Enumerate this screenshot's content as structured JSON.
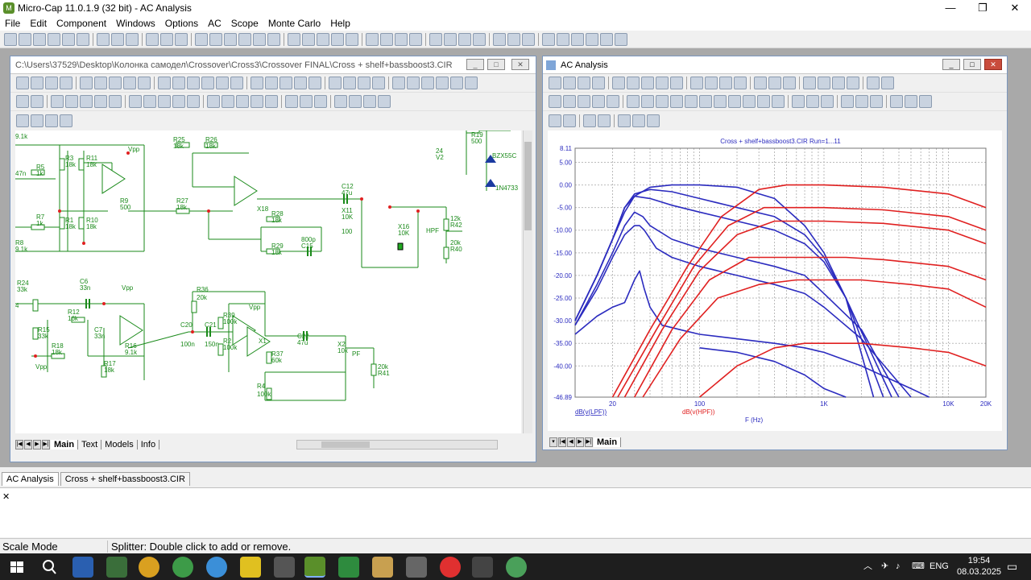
{
  "app": {
    "title": "Micro-Cap 11.0.1.9 (32 bit) - AC Analysis",
    "icon": "microcap-logo-icon"
  },
  "menu": [
    "File",
    "Edit",
    "Component",
    "Windows",
    "Options",
    "AC",
    "Scope",
    "Monte Carlo",
    "Help"
  ],
  "schematic": {
    "title": "C:\\Users\\37529\\Desktop\\Колонка самодел\\Crossover\\Cross3\\Crossover FINAL\\Cross + shelf+bassboost3.CIR",
    "tabs": [
      "Main",
      "Text",
      "Models",
      "Info"
    ],
    "labels": [
      {
        "t": "9.1k"
      },
      {
        "t": "Vpp"
      },
      {
        "t": "R25"
      },
      {
        "t": "18k"
      },
      {
        "t": "R26"
      },
      {
        "t": "18k"
      },
      {
        "t": "R19"
      },
      {
        "t": "500"
      },
      {
        "t": "24"
      },
      {
        "t": "V2"
      },
      {
        "t": "BZX55C"
      },
      {
        "t": "1N4733"
      },
      {
        "t": "R3"
      },
      {
        "t": "18k"
      },
      {
        "t": "R11"
      },
      {
        "t": "18k"
      },
      {
        "t": "R5"
      },
      {
        "t": "1k"
      },
      {
        "t": "47n"
      },
      {
        "t": "R9"
      },
      {
        "t": "500"
      },
      {
        "t": "R27"
      },
      {
        "t": "18k"
      },
      {
        "t": "X18"
      },
      {
        "t": "C12"
      },
      {
        "t": "47u"
      },
      {
        "t": "R28"
      },
      {
        "t": "18k"
      },
      {
        "t": "X11"
      },
      {
        "t": "10K"
      },
      {
        "t": "100"
      },
      {
        "t": "X16"
      },
      {
        "t": "10K"
      },
      {
        "t": "HPF"
      },
      {
        "t": "12k"
      },
      {
        "t": "R42"
      },
      {
        "t": "20k"
      },
      {
        "t": "R40"
      },
      {
        "t": "R7"
      },
      {
        "t": "1k"
      },
      {
        "t": "R1"
      },
      {
        "t": "18k"
      },
      {
        "t": "R10"
      },
      {
        "t": "18k"
      },
      {
        "t": "R29"
      },
      {
        "t": "18k"
      },
      {
        "t": "800p"
      },
      {
        "t": "C15"
      },
      {
        "t": "R8"
      },
      {
        "t": "9.1k"
      },
      {
        "t": "R24"
      },
      {
        "t": "33k"
      },
      {
        "t": "C6"
      },
      {
        "t": "33n"
      },
      {
        "t": "Vpp"
      },
      {
        "t": "R36"
      },
      {
        "t": "20k"
      },
      {
        "t": "R12"
      },
      {
        "t": "16k"
      },
      {
        "t": "C7"
      },
      {
        "t": "33n"
      },
      {
        "t": "R39"
      },
      {
        "t": "100k"
      },
      {
        "t": "Vpp"
      },
      {
        "t": "R15"
      },
      {
        "t": "33k"
      },
      {
        "t": "C20"
      },
      {
        "t": "C21"
      },
      {
        "t": "100n"
      },
      {
        "t": "150n"
      },
      {
        "t": "R2"
      },
      {
        "t": "100k"
      },
      {
        "t": "X1"
      },
      {
        "t": "C22"
      },
      {
        "t": "47u"
      },
      {
        "t": "R18"
      },
      {
        "t": "18k"
      },
      {
        "t": "R16"
      },
      {
        "t": "9.1k"
      },
      {
        "t": "R37"
      },
      {
        "t": "60k"
      },
      {
        "t": "X2"
      },
      {
        "t": "10k"
      },
      {
        "t": "PF"
      },
      {
        "t": "20k"
      },
      {
        "t": "R41"
      },
      {
        "t": "Vpp"
      },
      {
        "t": "R17"
      },
      {
        "t": "18k"
      },
      {
        "t": "R4"
      },
      {
        "t": "100k"
      },
      {
        "t": "4"
      }
    ]
  },
  "analysis": {
    "window_title": "AC Analysis",
    "tabs": [
      "Main"
    ],
    "chart_data": {
      "type": "line",
      "title": "Cross + shelf+bassboost3.CIR Run=1...11",
      "xlabel": "F (Hz)",
      "x_scale": "log",
      "xlim": [
        10,
        20000
      ],
      "x_ticks": [
        "20",
        "100",
        "1K",
        "10K",
        "20K"
      ],
      "y_ticks": [
        "8.11",
        "5.00",
        "0.00",
        "-5.00",
        "-10.00",
        "-15.00",
        "-20.00",
        "-25.00",
        "-30.00",
        "-35.00",
        "-40.00",
        "-46.89"
      ],
      "ylim": [
        -46.89,
        8.11
      ],
      "grid": true,
      "legend": [
        {
          "label": "dB(v(LPF))",
          "color": "#2b2bbf"
        },
        {
          "label": "dB(v(HPF))",
          "color": "#e02020"
        }
      ],
      "series": [
        {
          "color": "#2b2bbf",
          "x": [
            10,
            15,
            20,
            25,
            30,
            40,
            60,
            100,
            200,
            400,
            700,
            1000,
            1500,
            2500
          ],
          "y": [
            -30,
            -20,
            -12,
            -6,
            -2.5,
            -0.5,
            0,
            0,
            -0.5,
            -3,
            -9,
            -15,
            -25,
            -46.89
          ]
        },
        {
          "color": "#2b2bbf",
          "x": [
            10,
            15,
            20,
            25,
            30,
            40,
            60,
            100,
            200,
            400,
            700,
            1000,
            1500,
            3000
          ],
          "y": [
            -30,
            -20,
            -12,
            -5,
            -2,
            -1,
            -1.5,
            -3,
            -5,
            -7,
            -11,
            -16,
            -25,
            -46.89
          ]
        },
        {
          "color": "#2b2bbf",
          "x": [
            10,
            15,
            20,
            25,
            30,
            40,
            60,
            100,
            200,
            400,
            700,
            1000,
            1500,
            3500
          ],
          "y": [
            -30,
            -20,
            -12,
            -5,
            -2.5,
            -3,
            -4.5,
            -6,
            -8,
            -10,
            -13,
            -17,
            -25,
            -46.89
          ]
        },
        {
          "color": "#2b2bbf",
          "x": [
            10,
            15,
            20,
            25,
            30,
            35,
            40,
            60,
            100,
            200,
            400,
            700,
            1000,
            2000,
            4000
          ],
          "y": [
            -31,
            -22,
            -15,
            -9,
            -6,
            -7,
            -9,
            -12,
            -14,
            -16,
            -18,
            -20,
            -24,
            -32,
            -46.89
          ]
        },
        {
          "color": "#2b2bbf",
          "x": [
            10,
            15,
            20,
            25,
            30,
            33,
            36,
            45,
            60,
            100,
            200,
            400,
            700,
            1000,
            2000,
            5000
          ],
          "y": [
            -31,
            -23,
            -16,
            -11,
            -9,
            -9,
            -10,
            -14,
            -16,
            -18,
            -20,
            -22,
            -24,
            -27,
            -34,
            -46.89
          ]
        },
        {
          "color": "#2b2bbf",
          "x": [
            10,
            15,
            20,
            25,
            30,
            33,
            36,
            40,
            50,
            70,
            100,
            200,
            400,
            700,
            1000,
            2000,
            5000,
            7000
          ],
          "y": [
            -33,
            -29,
            -27,
            -26,
            -21,
            -19,
            -23,
            -27,
            -31,
            -32,
            -33,
            -34,
            -35,
            -36,
            -37,
            -40,
            -45,
            -46.89
          ]
        },
        {
          "color": "#2b2bbf",
          "x": [
            100,
            200,
            400,
            700,
            1000,
            1500
          ],
          "y": [
            -36,
            -37,
            -39,
            -42,
            -45,
            -46.89
          ]
        },
        {
          "color": "#e02020",
          "x": [
            20,
            40,
            80,
            150,
            300,
            500,
            1000,
            3000,
            10000,
            20000
          ],
          "y": [
            -46.89,
            -32,
            -18,
            -7,
            -1,
            0,
            0,
            -0.5,
            -2,
            -5
          ]
        },
        {
          "color": "#e02020",
          "x": [
            22,
            45,
            90,
            170,
            330,
            600,
            1000,
            3000,
            10000,
            20000
          ],
          "y": [
            -46.89,
            -32,
            -18,
            -9,
            -5,
            -5,
            -5,
            -5.5,
            -7,
            -10
          ]
        },
        {
          "color": "#e02020",
          "x": [
            25,
            50,
            100,
            200,
            400,
            700,
            1000,
            3000,
            10000,
            20000
          ],
          "y": [
            -46.89,
            -32,
            -19,
            -11,
            -8,
            -8,
            -8,
            -8.5,
            -10,
            -13
          ]
        },
        {
          "color": "#e02020",
          "x": [
            30,
            60,
            120,
            250,
            500,
            800,
            1500,
            3000,
            10000,
            20000
          ],
          "y": [
            -46.89,
            -32,
            -21,
            -16,
            -16,
            -16,
            -16,
            -16.5,
            -18,
            -21
          ]
        },
        {
          "color": "#e02020",
          "x": [
            35,
            70,
            140,
            300,
            600,
            1000,
            2000,
            5000,
            10000,
            20000
          ],
          "y": [
            -46.89,
            -34,
            -25,
            -22,
            -21,
            -21,
            -21,
            -22,
            -23,
            -27
          ]
        },
        {
          "color": "#e02020",
          "x": [
            100,
            200,
            400,
            700,
            1000,
            2000,
            5000,
            10000,
            20000
          ],
          "y": [
            -46.89,
            -40,
            -36,
            -35,
            -35,
            -35,
            -36,
            -37,
            -40
          ]
        }
      ]
    }
  },
  "doc_tabs": [
    "AC Analysis",
    "Cross + shelf+bassboost3.CIR"
  ],
  "status": {
    "mode": "Scale Mode",
    "hint": "Splitter: Double click to add or remove."
  },
  "taskbar": {
    "lang": "ENG",
    "time": "19:54",
    "date": "08.03.2025"
  }
}
